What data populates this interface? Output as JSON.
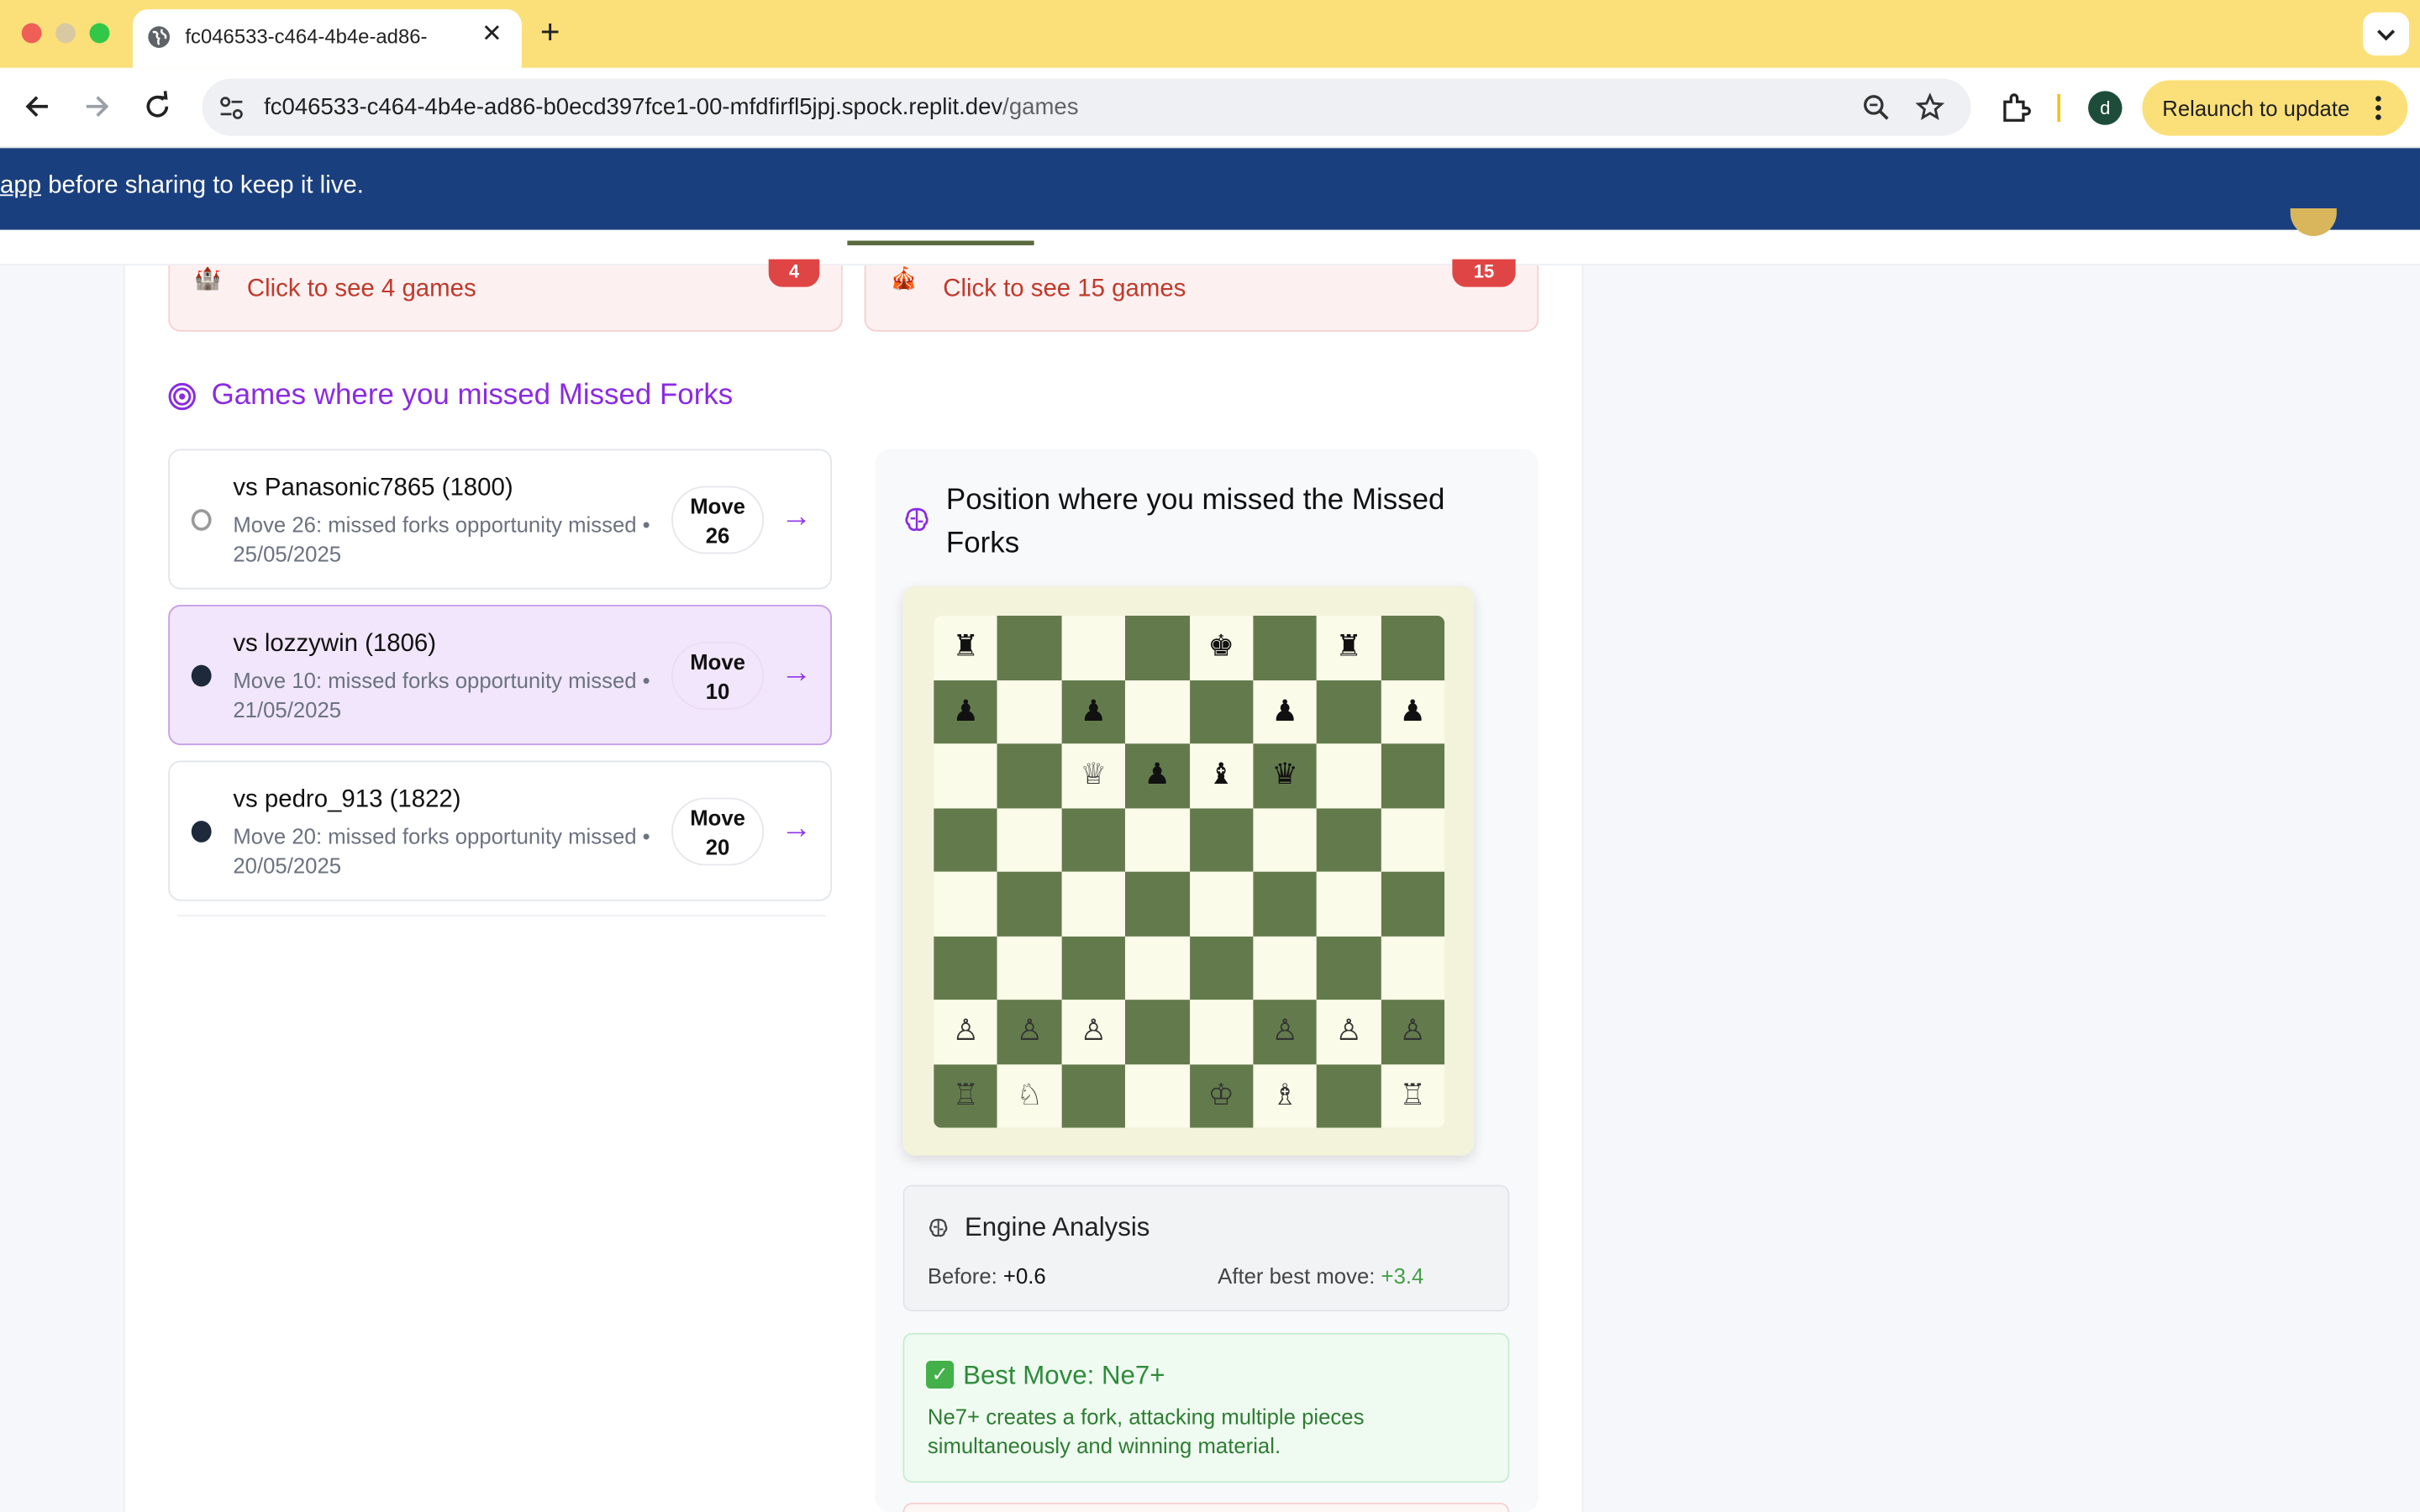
{
  "browser": {
    "tab_title": "fc046533-c464-4b4e-ad86-",
    "url_host": "fc046533-c464-4b4e-ad86-b0ecd397fce1-00-mfdfirfl5jpj.spock.replit.dev",
    "url_path": "/games",
    "relaunch_label": "Relaunch to update",
    "profile_initial": "d"
  },
  "banner": {
    "link_text": "app",
    "text": " before sharing to keep it live."
  },
  "categories": [
    {
      "label": "Click to see 4 games",
      "badge": "4",
      "icon": "castle-icon"
    },
    {
      "label": "Click to see 15 games",
      "badge": "15",
      "icon": "circus-tent-icon"
    }
  ],
  "section": {
    "title": "Games where you missed Missed Forks"
  },
  "games": [
    {
      "opponent": "vs Panasonic7865 (1800)",
      "desc": "Move 26: missed forks opportunity missed • 25/05/2025",
      "move_label": "Move",
      "move_num": "26",
      "color": "white",
      "selected": false
    },
    {
      "opponent": "vs lozzywin (1806)",
      "desc": "Move 10: missed forks opportunity missed • 21/05/2025",
      "move_label": "Move",
      "move_num": "10",
      "color": "black",
      "selected": true
    },
    {
      "opponent": "vs pedro_913 (1822)",
      "desc": "Move 20: missed forks opportunity missed • 20/05/2025",
      "move_label": "Move",
      "move_num": "20",
      "color": "black",
      "selected": false
    }
  ],
  "position": {
    "title": "Position where you missed the Missed Forks",
    "board": [
      [
        "♜",
        "",
        "",
        "",
        "♚",
        "",
        "♜",
        ""
      ],
      [
        "♟",
        "",
        "♟",
        "",
        "",
        "♟",
        "",
        "♟"
      ],
      [
        "",
        "",
        "♕",
        "♟",
        "♝",
        "♛",
        "",
        ""
      ],
      [
        "",
        "",
        "",
        "",
        "",
        "",
        "",
        ""
      ],
      [
        "",
        "",
        "",
        "",
        "",
        "",
        "",
        ""
      ],
      [
        "",
        "",
        "",
        "",
        "",
        "",
        "",
        ""
      ],
      [
        "♙",
        "♙",
        "♙",
        "",
        "",
        "♙",
        "♙",
        "♙"
      ],
      [
        "♖",
        "♘",
        "",
        "",
        "♔",
        "♗",
        "",
        "♖"
      ]
    ]
  },
  "engine": {
    "title": "Engine Analysis",
    "before_label": "Before:",
    "before_value": "+0.6",
    "after_label": "After best move:",
    "after_value": "+3.4"
  },
  "best_move": {
    "title": "Best Move: Ne7+",
    "desc": "Ne7+ creates a fork, attacking multiple pieces simultaneously and winning material."
  }
}
